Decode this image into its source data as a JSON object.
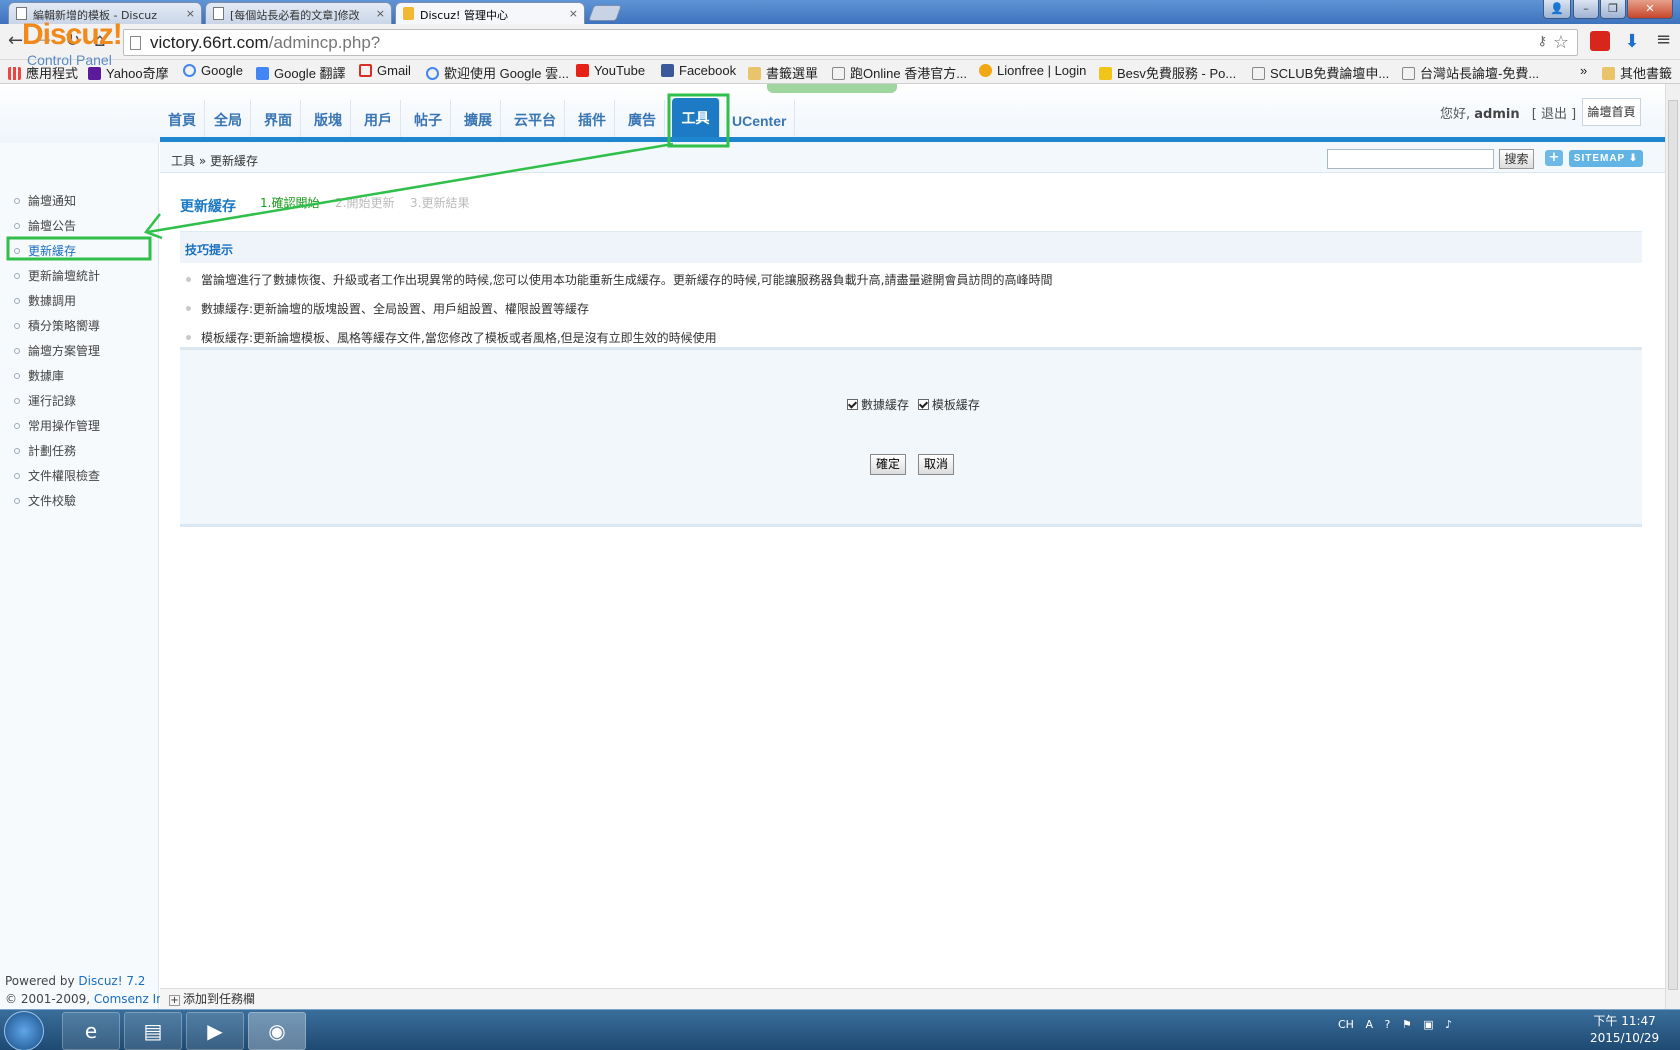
{
  "browser": {
    "tabs": [
      {
        "title": "編輯新增的模板 - Discuz",
        "close": "×"
      },
      {
        "title": "[每個站長必看的文章]修改",
        "close": "×"
      },
      {
        "title": "Discuz! 管理中心",
        "close": "×"
      }
    ],
    "window_controls": {
      "minimize": "–",
      "maximize": "❐",
      "close": "✕"
    },
    "nav": {
      "back": "←",
      "forward": "→",
      "reload": "↻",
      "home": "⌂",
      "menu": "≡"
    },
    "url_host": "victory.66rt.com",
    "url_path": "/admincp.php?",
    "bookmarks": [
      {
        "label": "應用程式",
        "icon": "apps-icon"
      },
      {
        "label": "Yahoo奇摩",
        "icon": "yahoo-icon"
      },
      {
        "label": "Google",
        "icon": "google-icon"
      },
      {
        "label": "Google 翻譯",
        "icon": "translate-icon"
      },
      {
        "label": "Gmail",
        "icon": "gmail-icon"
      },
      {
        "label": "歡迎使用 Google 雲...",
        "icon": "google-icon"
      },
      {
        "label": "YouTube",
        "icon": "youtube-icon"
      },
      {
        "label": "Facebook",
        "icon": "facebook-icon"
      },
      {
        "label": "書籤選單",
        "icon": "folder-icon"
      },
      {
        "label": "跑Online 香港官方...",
        "icon": "page-icon"
      },
      {
        "label": "Lionfree | Login",
        "icon": "lionfree-icon"
      },
      {
        "label": "Besv免費服務 - Po...",
        "icon": "besv-icon"
      },
      {
        "label": "SCLUB免費論壇申...",
        "icon": "page-icon"
      },
      {
        "label": "台灣站長論壇-免費...",
        "icon": "page-icon"
      }
    ],
    "bookmarks_more": "»",
    "other_bookmarks": "其他書籤"
  },
  "header": {
    "logo": "Discuz!",
    "logo_sub": "Control Panel",
    "nav": [
      "首頁",
      "全局",
      "界面",
      "版塊",
      "用戶",
      "帖子",
      "擴展",
      "云平台",
      "插件",
      "廣告",
      "工具",
      "UCenter"
    ],
    "active_nav": "工具",
    "greeting": "您好,",
    "username": "admin",
    "logout": "[ 退出 ]",
    "forum_home": "論壇首頁"
  },
  "toolbar": {
    "breadcrumb": "工具 » 更新緩存",
    "search_button": "搜索",
    "plus": "+",
    "sitemap": "SITEMAP ⬇"
  },
  "sidebar": {
    "items": [
      "論壇通知",
      "論壇公告",
      "更新緩存",
      "更新論壇統計",
      "數據調用",
      "積分策略嚮導",
      "論壇方案管理",
      "數據庫",
      "運行記錄",
      "常用操作管理",
      "計劃任務",
      "文件權限檢查",
      "文件校驗"
    ],
    "active": "更新緩存",
    "powered_prefix": "Powered by",
    "powered_link": "Discuz! 7.2",
    "copyright_prefix": "© 2001-2009,",
    "copyright_link": "Comsenz Inc."
  },
  "main": {
    "title": "更新緩存",
    "steps": [
      "1.確認開始",
      "2.開始更新",
      "3.更新結果"
    ],
    "tips_title": "技巧提示",
    "tips": [
      "當論壇進行了數據恢復、升級或者工作出現異常的時候,您可以使用本功能重新生成緩存。更新緩存的時候,可能讓服務器負載升高,請盡量避開會員訪問的高峰時間",
      "數據緩存:更新論壇的版塊設置、全局設置、用戶組設置、權限設置等緩存",
      "模板緩存:更新論壇模板、風格等緩存文件,當您修改了模板或者風格,但是沒有立即生效的時候使用"
    ],
    "checkbox_data": "數據緩存",
    "checkbox_template": "模板緩存",
    "confirm": "確定",
    "cancel": "取消",
    "add_to_taskbar": "添加到任務欄"
  },
  "taskbar": {
    "lang": "CH",
    "time": "下午 11:47",
    "date": "2015/10/29"
  },
  "colors": {
    "accent": "#1c7bc4",
    "annotation": "#2fbf4a",
    "logo": "#f08a1c"
  }
}
